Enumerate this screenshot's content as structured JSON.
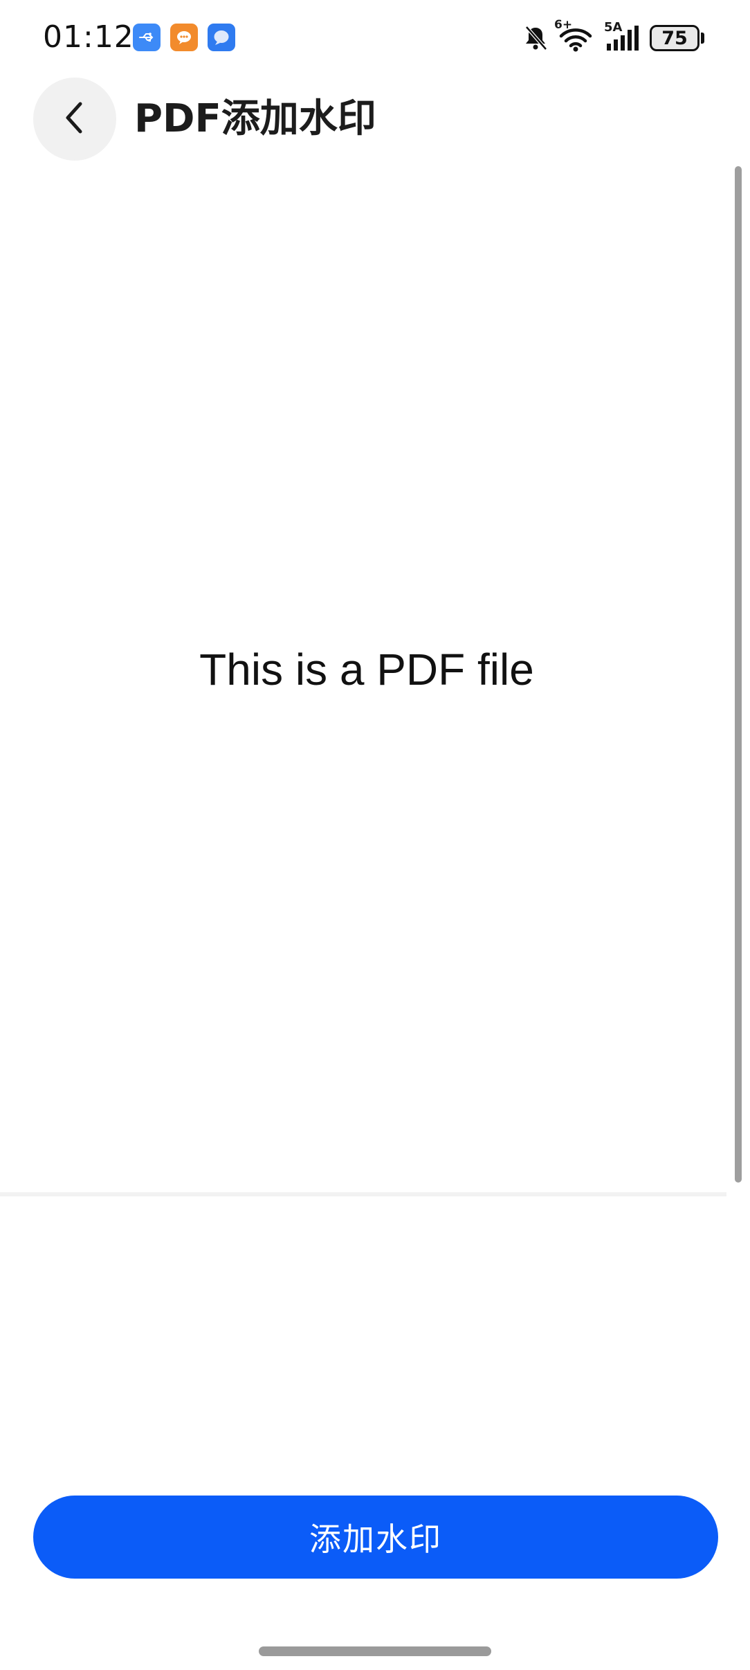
{
  "status_bar": {
    "time": "01:12",
    "network_superscript": "6+",
    "network_label": "5A",
    "battery_level": "75"
  },
  "header": {
    "title": "PDF添加水印"
  },
  "preview": {
    "text": "This is a PDF file"
  },
  "actions": {
    "add_watermark_label": "添加水印"
  },
  "colors": {
    "primary": "#0b5cf8",
    "back_button_bg": "#f1f1f1",
    "scrollbar": "#9e9e9e"
  }
}
